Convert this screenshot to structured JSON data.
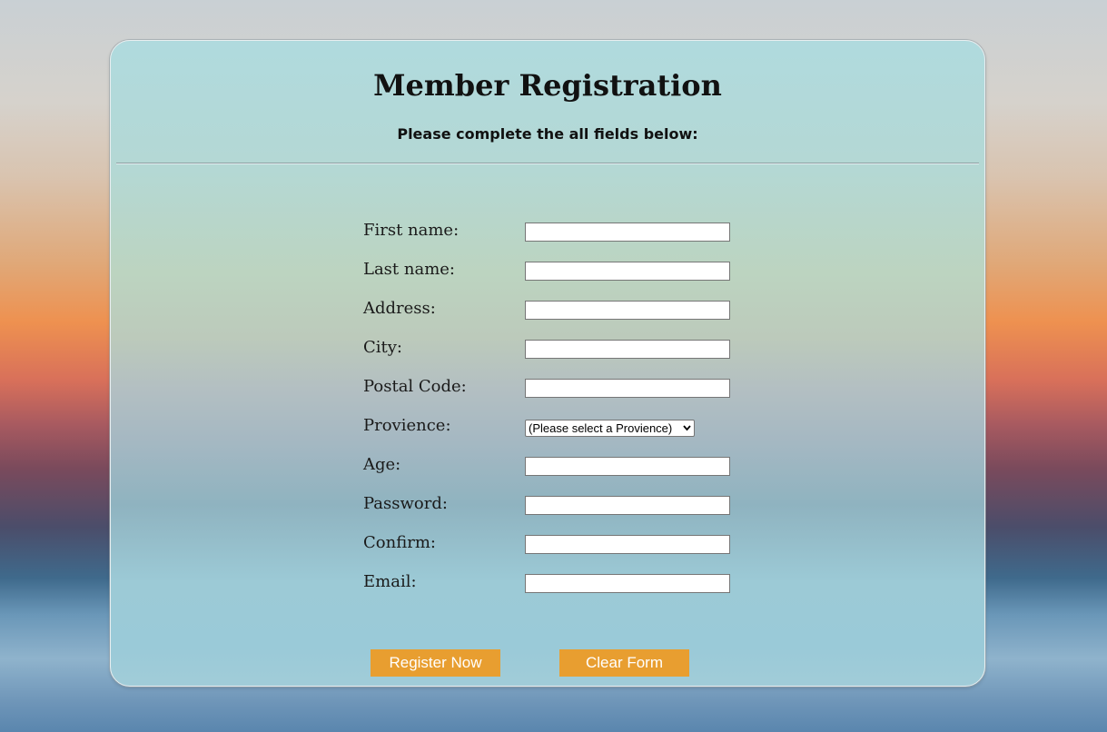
{
  "form": {
    "title": "Member Registration",
    "subtitle": "Please complete the all fields below:",
    "fields": [
      {
        "label": "First name:",
        "value": ""
      },
      {
        "label": "Last name:",
        "value": ""
      },
      {
        "label": "Address:",
        "value": ""
      },
      {
        "label": "City:",
        "value": ""
      },
      {
        "label": "Postal Code:",
        "value": ""
      },
      {
        "label": "Provience:",
        "selected": "(Please select a Provience)"
      },
      {
        "label": "Age:",
        "value": ""
      },
      {
        "label": "Password:",
        "value": ""
      },
      {
        "label": "Confirm:",
        "value": ""
      },
      {
        "label": "Email:",
        "value": ""
      }
    ],
    "buttons": {
      "register": "Register Now",
      "clear": "Clear Form"
    }
  },
  "colors": {
    "button": "#e89e30",
    "button_text": "#ffffff"
  }
}
